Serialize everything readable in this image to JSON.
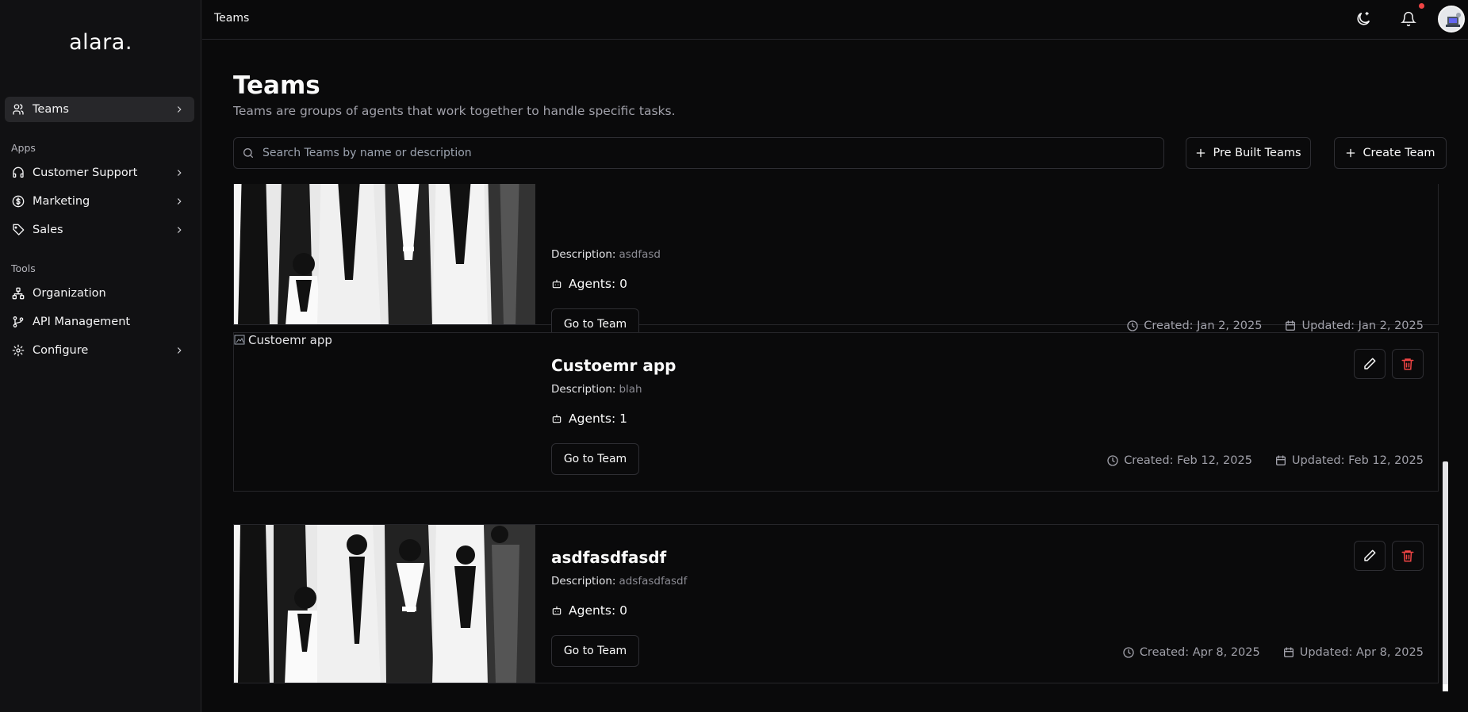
{
  "app": {
    "logo_text": "alara."
  },
  "sidebar": {
    "primary": [
      {
        "label": "Teams",
        "icon": "users-icon"
      }
    ],
    "apps_label": "Apps",
    "apps": [
      {
        "label": "Customer Support",
        "icon": "headset-icon"
      },
      {
        "label": "Marketing",
        "icon": "dollar-circle-icon"
      },
      {
        "label": "Sales",
        "icon": "tag-icon"
      }
    ],
    "tools_label": "Tools",
    "tools": [
      {
        "label": "Organization",
        "icon": "org-chart-icon"
      },
      {
        "label": "API Management",
        "icon": "git-branch-icon"
      },
      {
        "label": "Configure",
        "icon": "gear-icon"
      }
    ]
  },
  "topbar": {
    "breadcrumb": "Teams",
    "notification_dot_color": "#ef4444"
  },
  "page": {
    "title": "Teams",
    "subtitle": "Teams are groups of agents that work together to handle specific tasks.",
    "search_placeholder": "Search Teams by name or description",
    "prebuilt_label": "Pre Built Teams",
    "create_label": "Create Team"
  },
  "teams": [
    {
      "name": "",
      "description_label": "Description:",
      "description": "asdfasd",
      "agents_label": "Agents: 0",
      "go_label": "Go to Team",
      "created": "Created: Jan 2, 2025",
      "updated": "Updated: Jan 2, 2025",
      "image": "team-illustration"
    },
    {
      "name": "Custoemr app",
      "image_alt": "Custoemr app",
      "description_label": "Description:",
      "description": "blah",
      "agents_label": "Agents: 1",
      "go_label": "Go to Team",
      "created": "Created: Feb 12, 2025",
      "updated": "Updated: Feb 12, 2025",
      "image": "broken-image"
    },
    {
      "name": "asdfasdfasdf",
      "description_label": "Description:",
      "description": "adsfasdfasdf",
      "agents_label": "Agents: 0",
      "go_label": "Go to Team",
      "created": "Created: Apr 8, 2025",
      "updated": "Updated: Apr 8, 2025",
      "image": "team-illustration"
    }
  ],
  "colors": {
    "accent_delete": "#ef4444",
    "background": "#0a0a0b",
    "sidebar": "#111113"
  }
}
